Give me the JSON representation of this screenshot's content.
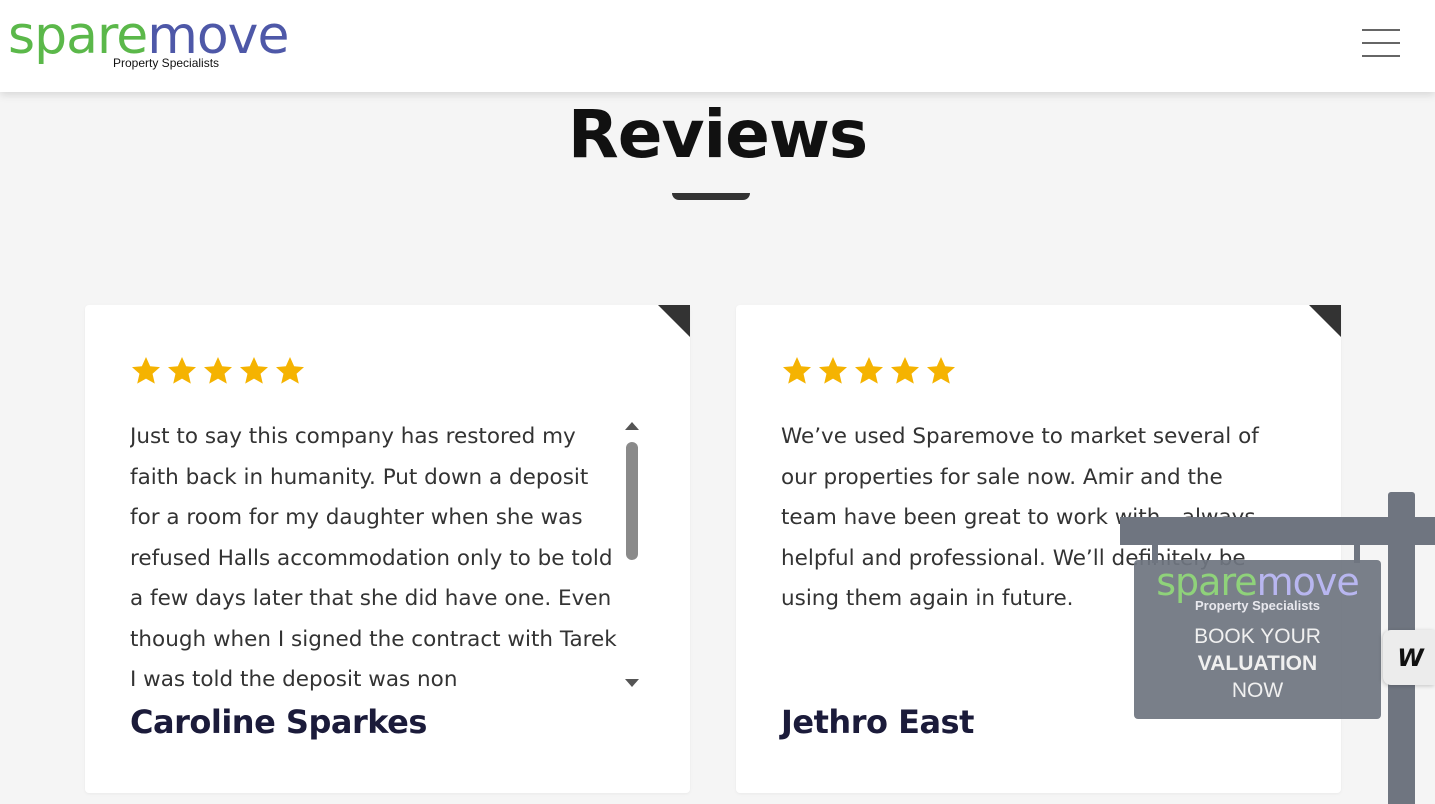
{
  "header": {
    "logo_part1": "spare",
    "logo_part2": "move",
    "logo_tagline": "Property Specialists",
    "menu_icon": "hamburger-menu-icon"
  },
  "section": {
    "title": "Reviews"
  },
  "reviews": [
    {
      "rating": 5,
      "text": "Just to say this company has restored my faith back in humanity. Put down a deposit for a room for my daughter when she was refused Halls accommodation only to be told a few days later that she did have one. Even though when I signed the contract with Tarek I was told the deposit was non",
      "author": "Caroline Sparkes"
    },
    {
      "rating": 5,
      "text": "We’ve used Sparemove to market several of our properties for sale now. Amir and the team have been great to work with - always helpful and professional. We’ll definitely be using them again in future.",
      "author": "Jethro East"
    }
  ],
  "sign": {
    "logo_part1": "spare",
    "logo_part2": "move",
    "tagline": "Property Specialists",
    "cta_line1": "BOOK YOUR",
    "cta_line2": "VALUATION",
    "cta_line3": "NOW"
  },
  "widget_tab": {
    "label": "W"
  },
  "colors": {
    "star": "#f5b301",
    "logo_green": "#5bb84a",
    "logo_blue": "#4e58a8",
    "sign_grey": "#6f7580",
    "name_navy": "#1b1b3a"
  }
}
